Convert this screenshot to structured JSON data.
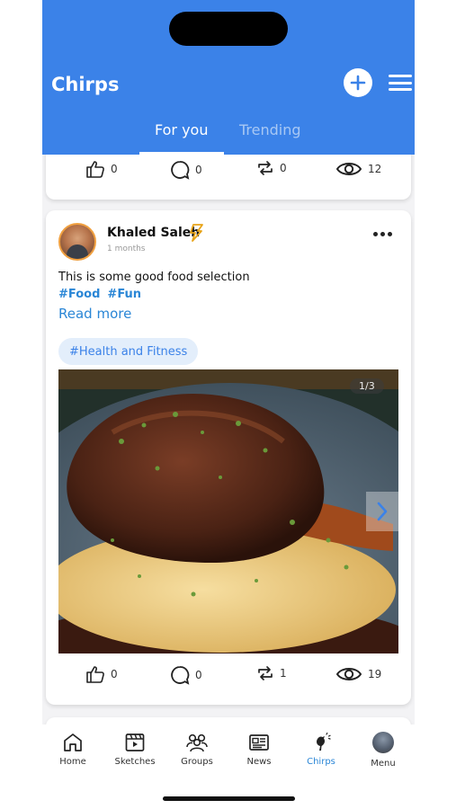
{
  "header": {
    "title": "Chirps",
    "tabs": [
      {
        "label": "For you",
        "active": true
      },
      {
        "label": "Trending",
        "active": false
      }
    ]
  },
  "colors": {
    "brand": "#3b82e8",
    "link": "#2a86d6",
    "chip_bg": "#e3eefb"
  },
  "posts": [
    {
      "stats": {
        "likes": "0",
        "comments": "0",
        "reposts": "0",
        "views": "12"
      }
    },
    {
      "author": "Khaled Saleh",
      "time_ago": "1 months",
      "text": "This is some good food selection",
      "hashtags": [
        "#Food",
        "#Fun"
      ],
      "read_more": "Read more",
      "topic_chip": "#Health and Fitness",
      "image_counter": "1/3",
      "stats": {
        "likes": "0",
        "comments": "0",
        "reposts": "1",
        "views": "19"
      }
    }
  ],
  "icons": [
    "plus-icon",
    "hamburger-menu-icon",
    "thumbs-up-icon",
    "comment-icon",
    "repost-icon",
    "eye-icon",
    "more-dots-icon",
    "lightning-badge-icon",
    "chevron-right-icon",
    "home-icon",
    "clapperboard-icon",
    "users-icon",
    "newspaper-icon",
    "bird-icon"
  ],
  "bottom_nav": [
    {
      "label": "Home",
      "icon": "home-icon"
    },
    {
      "label": "Sketches",
      "icon": "clapperboard-icon"
    },
    {
      "label": "Groups",
      "icon": "users-icon"
    },
    {
      "label": "News",
      "icon": "newspaper-icon"
    },
    {
      "label": "Chirps",
      "icon": "bird-icon",
      "active": true
    },
    {
      "label": "Menu",
      "icon": "avatar"
    }
  ]
}
